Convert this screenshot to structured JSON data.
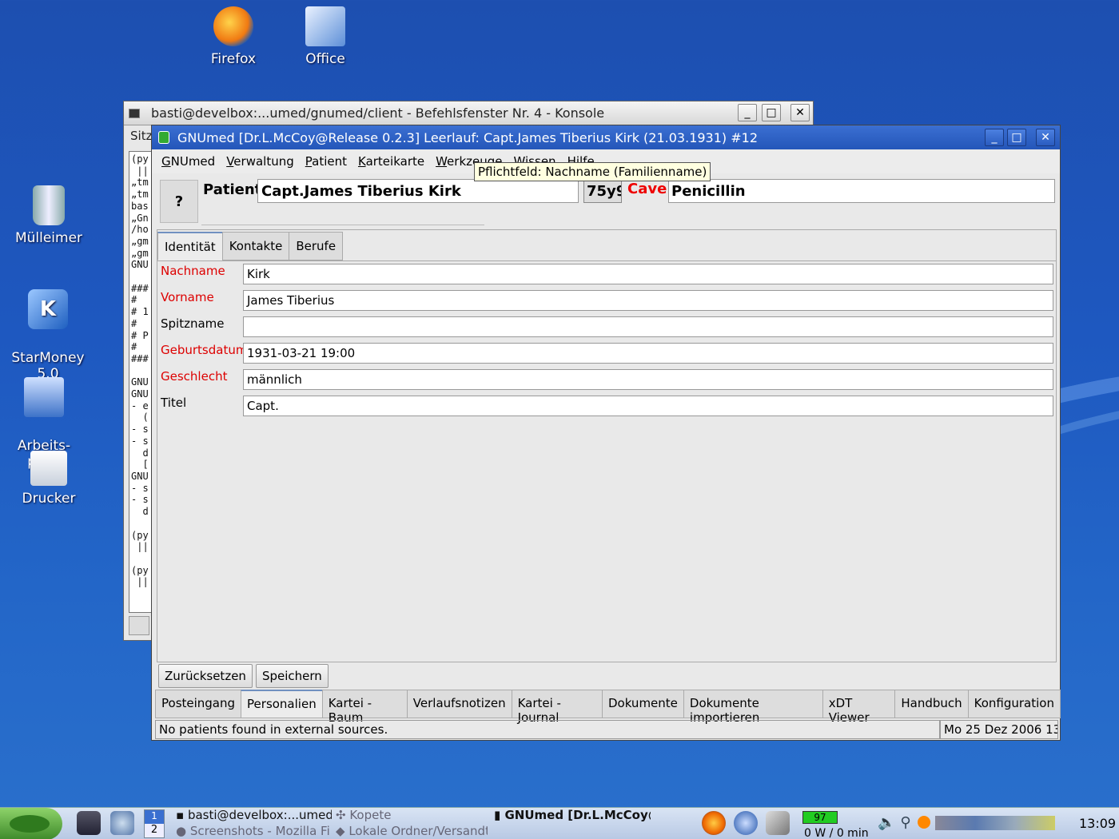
{
  "desktop": {
    "icons": [
      {
        "label": "Firefox",
        "icon": "firefox-icon"
      },
      {
        "label": "Office",
        "icon": "office-icon"
      },
      {
        "label": "Mülleimer",
        "icon": "trash-icon"
      },
      {
        "label": "StarMoney\n5.0",
        "icon": "starmoney-icon"
      },
      {
        "label": "Arbeits-\nplatz",
        "icon": "workstation-icon"
      },
      {
        "label": "Drucker",
        "icon": "printer-icon"
      }
    ]
  },
  "konsole": {
    "title": "basti@develbox:...umed/gnumed/client - Befehlsfenster Nr. 4 - Konsole",
    "menu_partial": "Sitz",
    "terminal_text": "(py\n ||\n„tm\n„tm\nbas\n„Gn\n/ho\n„gm\n„gm\nGNU\n\n###\n#\n# 1\n#\n# P\n#\n###\n\nGNU\nGNU\n- e\n  (\n- s\n- s\n  d\n  [\nGNU\n- s\n- s\n  d\n\n(py\n ||\n\n(py\n ||"
  },
  "gnumed": {
    "title": "GNUmed [Dr.L.McCoy@Release 0.2.3] Leerlauf: Capt.James Tiberius Kirk (21.03.1931) #12",
    "menu": [
      {
        "label": "GNUmed",
        "u": "G",
        "rest": "NUmed"
      },
      {
        "label": "Verwaltung",
        "u": "V",
        "rest": "erwaltung"
      },
      {
        "label": "Patient",
        "u": "P",
        "rest": "atient"
      },
      {
        "label": "Karteikarte",
        "u": "K",
        "rest": "arteikarte"
      },
      {
        "label": "Werkzeuge",
        "u": "W",
        "rest": "erkzeuge"
      },
      {
        "label": "Wissen",
        "u": "W",
        "rest": "issen"
      },
      {
        "label": "Hilfe",
        "pre": "H",
        "u": "i",
        "rest": "lfe"
      }
    ],
    "patient_photo_placeholder": "?",
    "patient_label": "Patient",
    "patient_name": "Capt.James Tiberius Kirk",
    "patient_age": "75y9",
    "cave_label": "Cave",
    "allergies": "Penicillin",
    "tabs": [
      "Identität",
      "Kontakte",
      "Berufe"
    ],
    "active_tab": 0,
    "fields": [
      {
        "label": "Nachname",
        "value": "Kirk",
        "required": true
      },
      {
        "label": "Vorname",
        "value": "James Tiberius",
        "required": true
      },
      {
        "label": "Spitzname",
        "value": "",
        "required": false
      },
      {
        "label": "Geburtsdatum",
        "value": "1931-03-21 19:00",
        "required": true
      },
      {
        "label": "Geschlecht",
        "value": "männlich",
        "required": true
      },
      {
        "label": "Titel",
        "value": "Capt.",
        "required": false
      }
    ],
    "tooltip": "Pflichtfeld: Nachname (Familienname)",
    "buttons": {
      "reset": "Zurücksetzen",
      "save": "Speichern"
    },
    "plugin_tabs": [
      "Posteingang",
      "Personalien",
      "Kartei - Baum",
      "Verlaufsnotizen",
      "Kartei - Journal",
      "Dokumente",
      "Dokumente importieren",
      "xDT Viewer",
      "Handbuch",
      "Konfiguration"
    ],
    "active_plugin_tab": 1,
    "status_message": "No patients found in external sources.",
    "status_datetime": "Mo 25 Dez 2006 13:"
  },
  "taskbar": {
    "desktop_pager": "1",
    "desktop_pager_2": "2",
    "tasks": [
      {
        "label": "basti@develbox:...umed/c"
      },
      {
        "label": "Kopete"
      },
      {
        "label": "Screenshots - Mozilla Fi"
      },
      {
        "label": "Lokale Ordner/Versandte"
      },
      {
        "label": "GNUmed [Dr.L.McCoy@"
      }
    ],
    "battery_percent": "97",
    "battery_status": "0 W / 0 min",
    "clock": "13:09",
    "colors": {
      "accent": "#3b6fd2",
      "required_label": "#dd0000",
      "desktop": "#1e58c0"
    }
  }
}
